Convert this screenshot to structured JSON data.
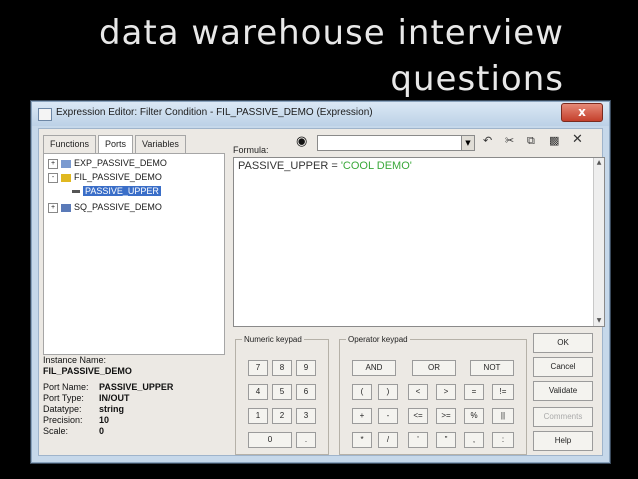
{
  "slide": {
    "title": "data warehouse interview\nquestions"
  },
  "window": {
    "title": "Expression Editor: Filter Condition - FIL_PASSIVE_DEMO (Expression)",
    "close_label": "x"
  },
  "tabs": [
    {
      "label": "Functions"
    },
    {
      "label": "Ports"
    },
    {
      "label": "Variables"
    }
  ],
  "tree": {
    "items": [
      {
        "label": "EXP_PASSIVE_DEMO"
      },
      {
        "label": "FIL_PASSIVE_DEMO"
      },
      {
        "label": "PASSIVE_UPPER"
      },
      {
        "label": "SQ_PASSIVE_DEMO"
      }
    ]
  },
  "info": {
    "instance_label": "Instance Name:",
    "instance_value": "FIL_PASSIVE_DEMO",
    "rows": [
      {
        "key": "Port Name:",
        "value": "PASSIVE_UPPER"
      },
      {
        "key": "Port Type:",
        "value": "IN/OUT"
      },
      {
        "key": "Datatype:",
        "value": "string"
      },
      {
        "key": "Precision:",
        "value": "10"
      },
      {
        "key": "Scale:",
        "value": "0"
      }
    ]
  },
  "formula": {
    "label": "Formula:",
    "lhs": "PASSIVE_UPPER = ",
    "rhs": "'COOL DEMO'"
  },
  "numeric_keypad": {
    "legend": "Numeric keypad",
    "keys": [
      "7",
      "8",
      "9",
      "4",
      "5",
      "6",
      "1",
      "2",
      "3",
      "0",
      "."
    ]
  },
  "operator_keypad": {
    "legend": "Operator keypad",
    "keys": [
      "AND",
      "OR",
      "NOT",
      "(",
      ")",
      "<",
      ">",
      "=",
      "!=",
      "+",
      "-",
      "<=",
      ">=",
      "%",
      "||",
      "*",
      "/",
      "'",
      "\"",
      ",",
      ":"
    ]
  },
  "side_buttons": {
    "ok": "OK",
    "cancel": "Cancel",
    "validate": "Validate",
    "comments": "Comments",
    "help": "Help"
  }
}
